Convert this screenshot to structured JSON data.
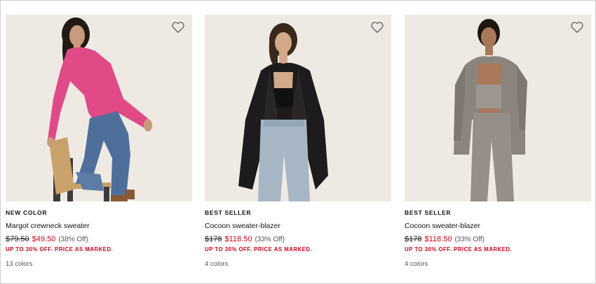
{
  "products": [
    {
      "badge": "NEW COLOR",
      "name": "Margot crewneck sweater",
      "original_price": "$79.50",
      "sale_price": "$49.50",
      "discount": "(38% Off)",
      "promo": "UP TO 30% OFF. PRICE AS MARKED.",
      "colors": "13 colors"
    },
    {
      "badge": "BEST SELLER",
      "name": "Cocoon sweater-blazer",
      "original_price": "$178",
      "sale_price": "$118.50",
      "discount": "(33% Off)",
      "promo": "UP TO 30% OFF. PRICE AS MARKED.",
      "colors": "4 colors"
    },
    {
      "badge": "BEST SELLER",
      "name": "Cocoon sweater-blazer",
      "original_price": "$178",
      "sale_price": "$118.50",
      "discount": "(33% Off)",
      "promo": "UP TO 30% OFF. PRICE AS MARKED.",
      "colors": "4 colors"
    }
  ],
  "icons": {
    "wishlist": "heart-outline-icon"
  },
  "colors": {
    "sale_red": "#d0021b",
    "photo_background": "#efe9e3"
  }
}
